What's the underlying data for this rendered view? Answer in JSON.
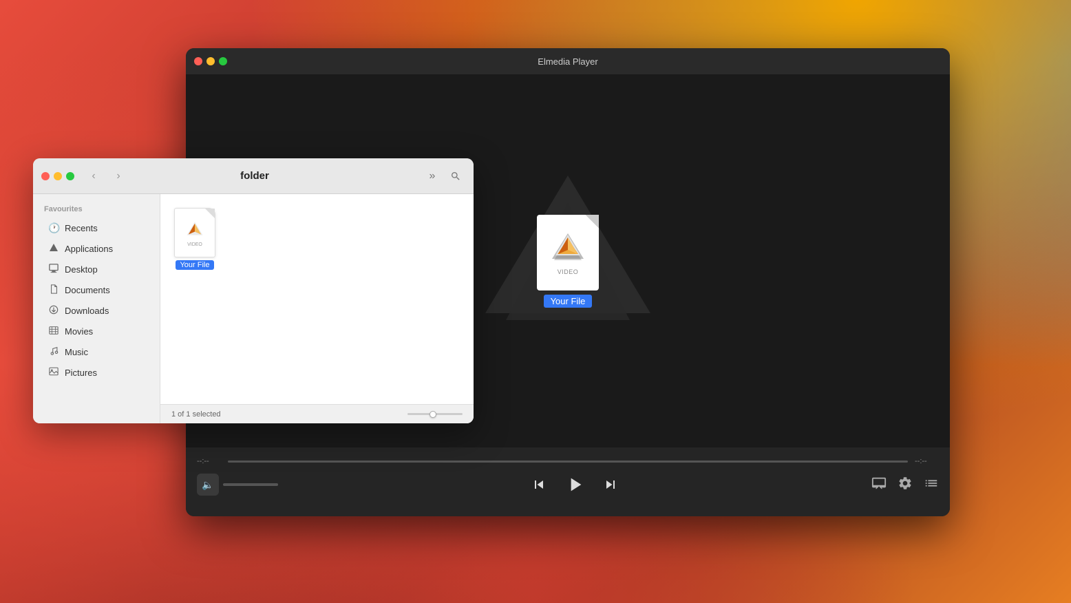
{
  "desktop": {
    "bg": "#c0392b"
  },
  "player": {
    "title": "Elmedia Player",
    "traffic_lights": [
      "close",
      "minimize",
      "maximize"
    ],
    "time_start": "--:--",
    "time_end": "--:--",
    "file_label": "VIDEO",
    "file_name": "Your File",
    "controls": {
      "previous": "⏮",
      "play": "▶",
      "next": "⏭",
      "airplay": "airplay",
      "settings": "gear",
      "playlist": "list"
    }
  },
  "finder": {
    "title": "folder",
    "traffic_lights": [
      "close",
      "minimize",
      "maximize"
    ],
    "nav": {
      "back": "‹",
      "forward": "›",
      "more": "»",
      "search": "🔍"
    },
    "sidebar": {
      "section_label": "Favourites",
      "items": [
        {
          "id": "recents",
          "label": "Recents",
          "icon": "🕐"
        },
        {
          "id": "applications",
          "label": "Applications",
          "icon": "✦"
        },
        {
          "id": "desktop",
          "label": "Desktop",
          "icon": "▣"
        },
        {
          "id": "documents",
          "label": "Documents",
          "icon": "📄"
        },
        {
          "id": "downloads",
          "label": "Downloads",
          "icon": "⊙"
        },
        {
          "id": "movies",
          "label": "Movies",
          "icon": "▦"
        },
        {
          "id": "music",
          "label": "Music",
          "icon": "♪"
        },
        {
          "id": "pictures",
          "label": "Pictures",
          "icon": "🖼"
        }
      ]
    },
    "content": {
      "file_label": "VIDEO",
      "file_name": "Your File"
    },
    "status": {
      "selection": "1 of 1 selected"
    }
  }
}
